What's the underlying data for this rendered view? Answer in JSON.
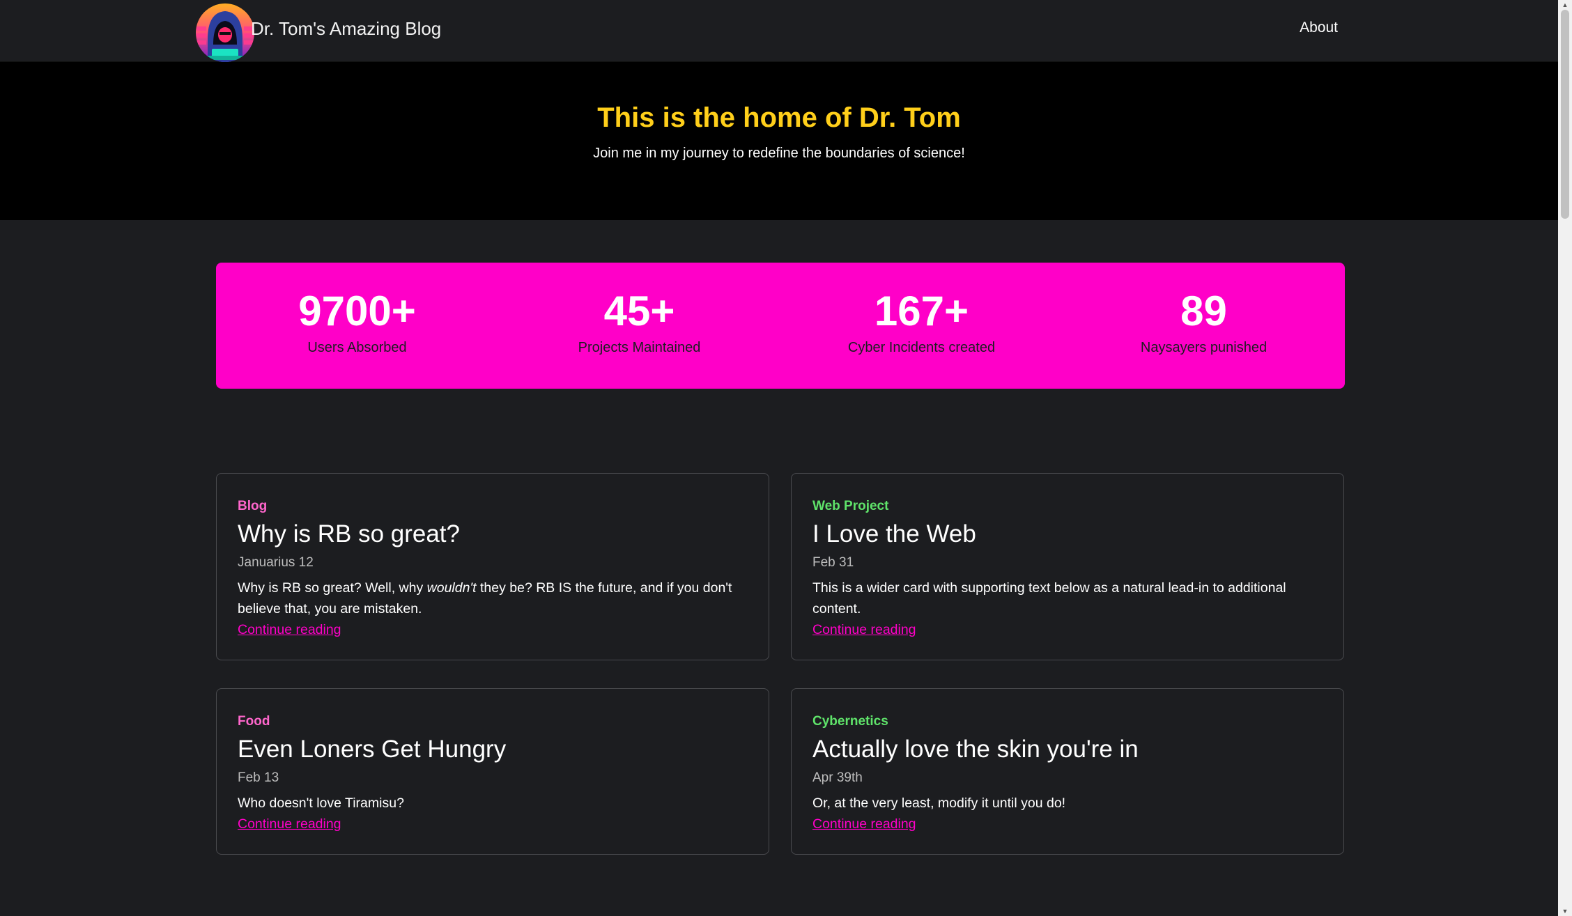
{
  "navbar": {
    "brand_title": "Dr. Tom's Amazing Blog",
    "about_label": "About"
  },
  "hero": {
    "title": "This is the home of Dr. Tom",
    "subtitle": "Join me in my journey to redefine the boundaries of science!"
  },
  "stats": [
    {
      "value": "9700+",
      "label": "Users Absorbed"
    },
    {
      "value": "45+",
      "label": "Projects Maintained"
    },
    {
      "value": "167+",
      "label": "Cyber Incidents created"
    },
    {
      "value": "89",
      "label": "Naysayers punished"
    }
  ],
  "cards": [
    {
      "category": "Blog",
      "title": "Why is RB so great?",
      "date": "Januarius 12",
      "excerpt_before": "Why is RB so great? Well, why ",
      "excerpt_em": "wouldn't",
      "excerpt_after": " they be? RB IS the future, and if you don't believe that, you are mistaken.",
      "link": "Continue reading"
    },
    {
      "category": "Web Project",
      "title": "I Love the Web",
      "date": "Feb 31",
      "excerpt": "This is a wider card with supporting text below as a natural lead-in to additional content.",
      "link": "Continue reading"
    },
    {
      "category": "Food",
      "title": "Even Loners Get Hungry",
      "date": "Feb 13",
      "excerpt": "Who doesn't love Tiramisu?",
      "link": "Continue reading"
    },
    {
      "category": "Cybernetics",
      "title": "Actually love the skin you're in",
      "date": "Apr 39th",
      "excerpt": "Or, at the very least, modify it until you do!",
      "link": "Continue reading"
    }
  ],
  "colors": {
    "accent_pink": "#ff00c8",
    "hero_title": "#ffcf1a",
    "category_pink": "#ff66cc",
    "category_green": "#5fe36a"
  },
  "icons": {
    "logo": "hooded-hacker-avatar-icon"
  }
}
